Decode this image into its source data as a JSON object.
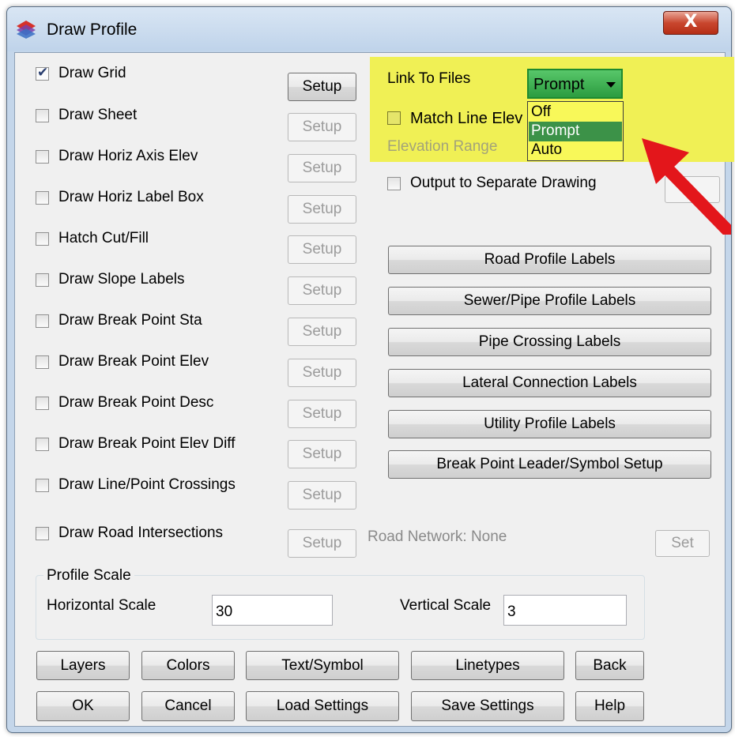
{
  "window": {
    "title": "Draw Profile",
    "close_label": "X"
  },
  "left_options": [
    {
      "label": "Draw Grid",
      "checked": true,
      "setup": "Setup",
      "setup_enabled": true
    },
    {
      "label": "Draw Sheet",
      "checked": false,
      "setup": "Setup",
      "setup_enabled": false
    },
    {
      "label": "Draw Horiz Axis Elev",
      "checked": false,
      "setup": "Setup",
      "setup_enabled": false
    },
    {
      "label": "Draw Horiz Label Box",
      "checked": false,
      "setup": "Setup",
      "setup_enabled": false
    },
    {
      "label": "Hatch Cut/Fill",
      "checked": false,
      "setup": "Setup",
      "setup_enabled": false
    },
    {
      "label": "Draw Slope Labels",
      "checked": false,
      "setup": "Setup",
      "setup_enabled": false
    },
    {
      "label": "Draw Break Point Sta",
      "checked": false,
      "setup": "Setup",
      "setup_enabled": false
    },
    {
      "label": "Draw Break Point Elev",
      "checked": false,
      "setup": "Setup",
      "setup_enabled": false
    },
    {
      "label": "Draw Break Point Desc",
      "checked": false,
      "setup": "Setup",
      "setup_enabled": false
    },
    {
      "label": "Draw Break Point Elev Diff",
      "checked": false,
      "setup": "Setup",
      "setup_enabled": false
    },
    {
      "label": "Draw Line/Point Crossings",
      "checked": false,
      "setup": "Setup",
      "setup_enabled": false
    },
    {
      "label": "Draw Road Intersections",
      "checked": false,
      "setup": "Setup",
      "setup_enabled": false
    }
  ],
  "road_network": {
    "label": "Road Network: None",
    "set_label": "Set"
  },
  "link_to_files": {
    "label": "Link To Files",
    "selected": "Prompt",
    "options": [
      "Off",
      "Prompt",
      "Auto"
    ]
  },
  "match_line_elev": {
    "label": "Match Line Elev",
    "checked": false
  },
  "elevation_range": {
    "label": "Elevation Range"
  },
  "output_separate": {
    "label": "Output to Separate Drawing",
    "checked": false
  },
  "label_buttons": [
    "Road Profile Labels",
    "Sewer/Pipe Profile Labels",
    "Pipe Crossing Labels",
    "Lateral Connection Labels",
    "Utility Profile Labels",
    "Break Point Leader/Symbol Setup"
  ],
  "profile_scale": {
    "group_label": "Profile Scale",
    "horizontal_label": "Horizontal Scale",
    "horizontal_value": "30",
    "vertical_label": "Vertical Scale",
    "vertical_value": "3"
  },
  "bottom_buttons": {
    "row1": [
      "Layers",
      "Colors",
      "Text/Symbol",
      "Linetypes",
      "Back"
    ],
    "row2": [
      "OK",
      "Cancel",
      "Load Settings",
      "Save Settings",
      "Help"
    ]
  },
  "colors": {
    "highlight": "#f0f055",
    "arrow": "#e3161b",
    "selected_option": "#3c9248"
  },
  "icons": [
    "app-icon",
    "close-icon",
    "chevron-down-icon",
    "red-arrow-annotation"
  ]
}
